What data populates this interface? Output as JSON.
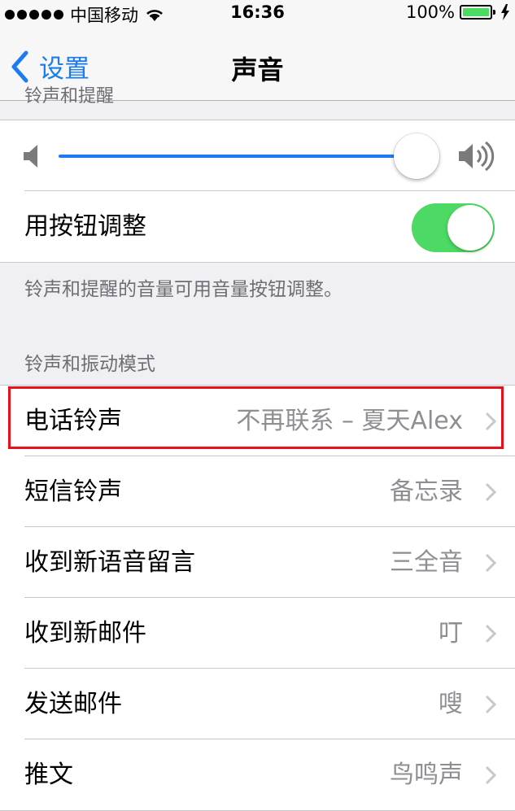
{
  "status_bar": {
    "carrier": "中国移动",
    "time": "16:36",
    "battery_percent": "100%",
    "signal_icon": "signal-dots-icon",
    "wifi_icon": "wifi-icon",
    "battery_icon": "battery-icon",
    "charging_icon": "charging-bolt-icon"
  },
  "nav": {
    "back_label": "设置",
    "title": "声音",
    "accent_color": "#1a7cf0"
  },
  "ringer_section": {
    "partial_header": "铃声和提醒",
    "volume_level": 0.93,
    "volume_low_icon": "speaker-low-icon",
    "volume_high_icon": "speaker-high-icon",
    "change_with_buttons_label": "用按钮调整",
    "change_with_buttons_on": true,
    "footer": "铃声和提醒的音量可用音量按钮调整。"
  },
  "sounds_section": {
    "header": "铃声和振动模式",
    "rows": [
      {
        "label": "电话铃声",
        "value": "不再联系 – 夏天Alex"
      },
      {
        "label": "短信铃声",
        "value": "备忘录"
      },
      {
        "label": "收到新语音留言",
        "value": "三全音"
      },
      {
        "label": "收到新邮件",
        "value": "叮"
      },
      {
        "label": "发送邮件",
        "value": "嗖"
      },
      {
        "label": "推文",
        "value": "鸟鸣声"
      }
    ]
  },
  "colors": {
    "toggle_on": "#4cd964",
    "highlight_box": "#e8101a"
  }
}
